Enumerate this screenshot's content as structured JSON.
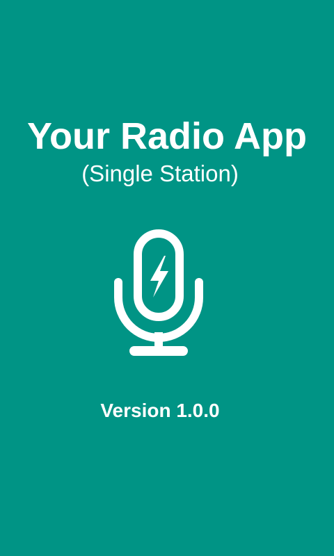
{
  "splash": {
    "title": "Your Radio App",
    "subtitle": "(Single Station)",
    "icon": "microphone-with-lightning-icon",
    "version": "Version 1.0.0"
  },
  "colors": {
    "background": "#009485",
    "foreground": "#ffffff"
  }
}
